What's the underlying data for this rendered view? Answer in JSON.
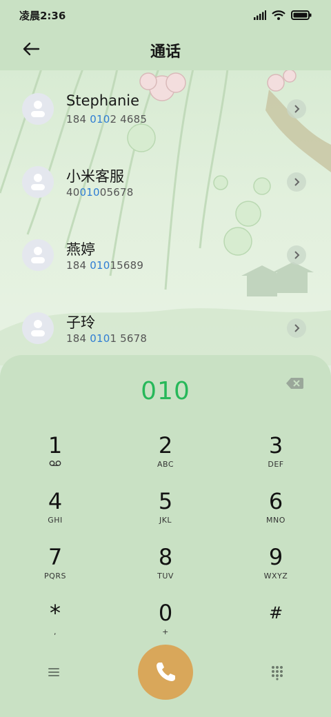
{
  "status_bar": {
    "time": "凌晨2:36",
    "icons": [
      "signal-icon",
      "wifi-icon",
      "battery-icon"
    ]
  },
  "header": {
    "title": "通话",
    "back_icon": "arrow-left-icon"
  },
  "contacts": [
    {
      "name": "Stephanie",
      "number_pre": "184 ",
      "number_match": "010",
      "number_post": "2 4685"
    },
    {
      "name": "小米客服",
      "number_pre": "40",
      "number_match": "010",
      "number_post": "05678"
    },
    {
      "name": "燕婷",
      "number_pre": "184 ",
      "number_match": "010",
      "number_post": "15689"
    },
    {
      "name": "子玲",
      "number_pre": "184 ",
      "number_match": "010",
      "number_post": "1 5678"
    }
  ],
  "dialpad": {
    "input": "010",
    "keys": [
      {
        "digit": "1",
        "sub": ""
      },
      {
        "digit": "2",
        "sub": "ABC"
      },
      {
        "digit": "3",
        "sub": "DEF"
      },
      {
        "digit": "4",
        "sub": "GHI"
      },
      {
        "digit": "5",
        "sub": "JKL"
      },
      {
        "digit": "6",
        "sub": "MNO"
      },
      {
        "digit": "7",
        "sub": "PQRS"
      },
      {
        "digit": "8",
        "sub": "TUV"
      },
      {
        "digit": "9",
        "sub": "WXYZ"
      },
      {
        "digit": "*",
        "sub": ","
      },
      {
        "digit": "0",
        "sub": "+"
      },
      {
        "digit": "#",
        "sub": ""
      }
    ]
  },
  "colors": {
    "accent_green": "#27b85a",
    "match_blue": "#2f7dd3",
    "call_button": "#d9a75a",
    "panel": "#c9e1c4"
  }
}
